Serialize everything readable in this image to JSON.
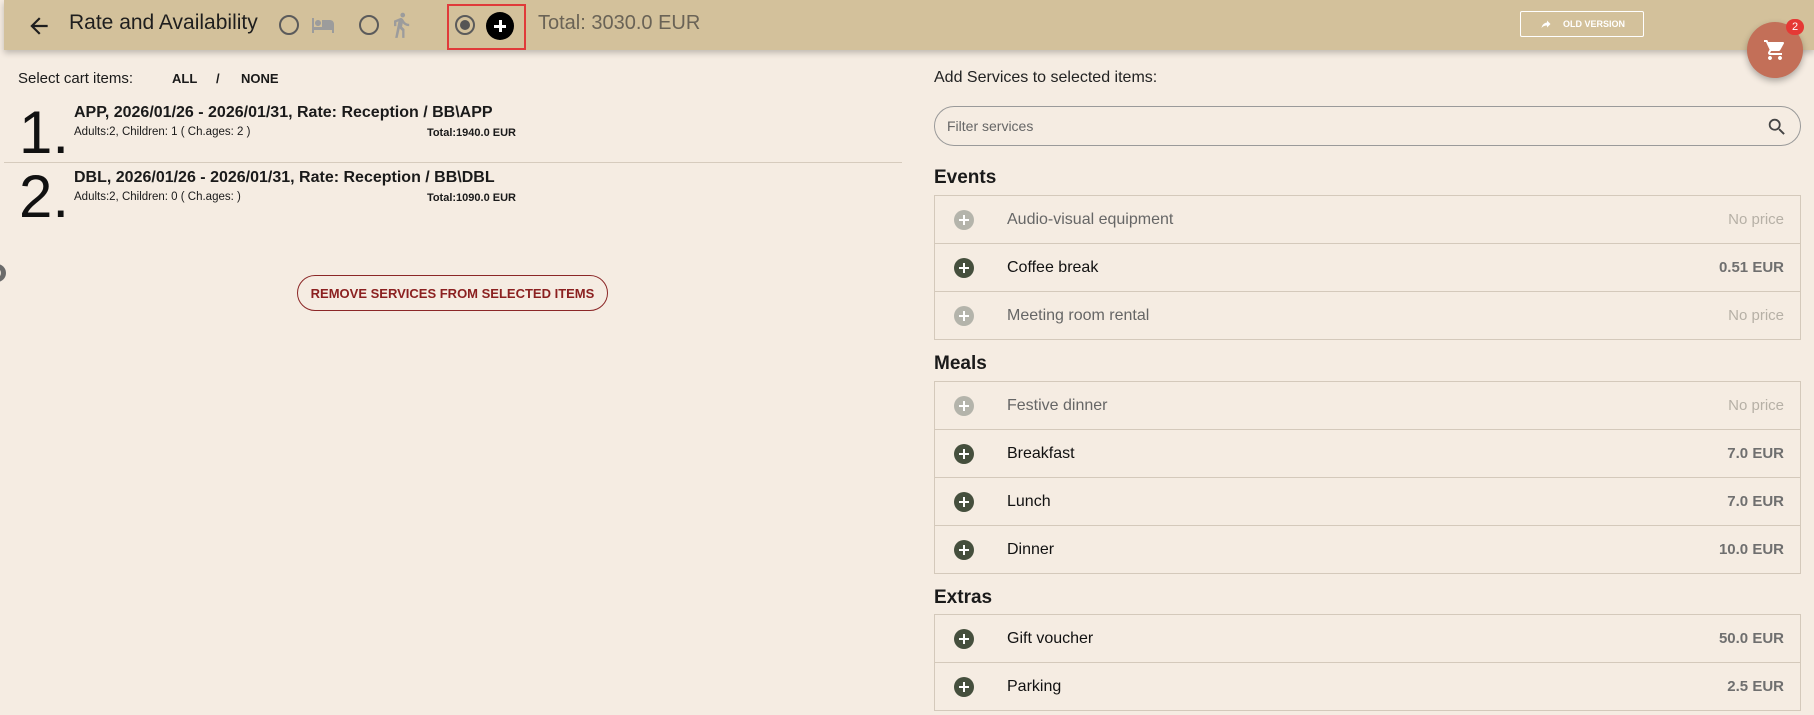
{
  "header": {
    "title": "Rate and Availability",
    "total": "Total: 3030.0 EUR",
    "old_version_label": "OLD VERSION",
    "cart_count": "2"
  },
  "cart": {
    "select_label": "Select cart items:",
    "all_label": "ALL",
    "separator": "/",
    "none_label": "NONE",
    "items": [
      {
        "number": "1.",
        "title": "APP, 2026/01/26 - 2026/01/31, Rate: Reception / BB\\APP",
        "guests": "Adults:2, Children: 1 ( Ch.ages: 2 )",
        "total": "Total:1940.0 EUR"
      },
      {
        "number": "2.",
        "title": "DBL, 2026/01/26 - 2026/01/31, Rate: Reception / BB\\DBL",
        "guests": "Adults:2, Children: 0 ( Ch.ages: )",
        "total": "Total:1090.0 EUR"
      }
    ],
    "remove_label": "REMOVE SERVICES FROM SELECTED ITEMS"
  },
  "services": {
    "title": "Add Services to selected items:",
    "filter_placeholder": "Filter services",
    "categories": [
      {
        "name": "Events",
        "items": [
          {
            "name": "Audio-visual equipment",
            "price": "No price",
            "available": false
          },
          {
            "name": "Coffee break",
            "price": "0.51 EUR",
            "available": true
          },
          {
            "name": "Meeting room rental",
            "price": "No price",
            "available": false
          }
        ]
      },
      {
        "name": "Meals",
        "items": [
          {
            "name": "Festive dinner",
            "price": "No price",
            "available": false
          },
          {
            "name": "Breakfast",
            "price": "7.0 EUR",
            "available": true
          },
          {
            "name": "Lunch",
            "price": "7.0 EUR",
            "available": true
          },
          {
            "name": "Dinner",
            "price": "10.0 EUR",
            "available": true
          }
        ]
      },
      {
        "name": "Extras",
        "items": [
          {
            "name": "Gift voucher",
            "price": "50.0 EUR",
            "available": true
          },
          {
            "name": "Parking",
            "price": "2.5 EUR",
            "available": true
          }
        ]
      }
    ]
  },
  "colors": {
    "header_bg": "#d3c19b",
    "page_bg": "#f5ece2",
    "cart_fab": "#c36f58",
    "remove_accent": "#8b2020",
    "highlight": "#e03a3a"
  }
}
